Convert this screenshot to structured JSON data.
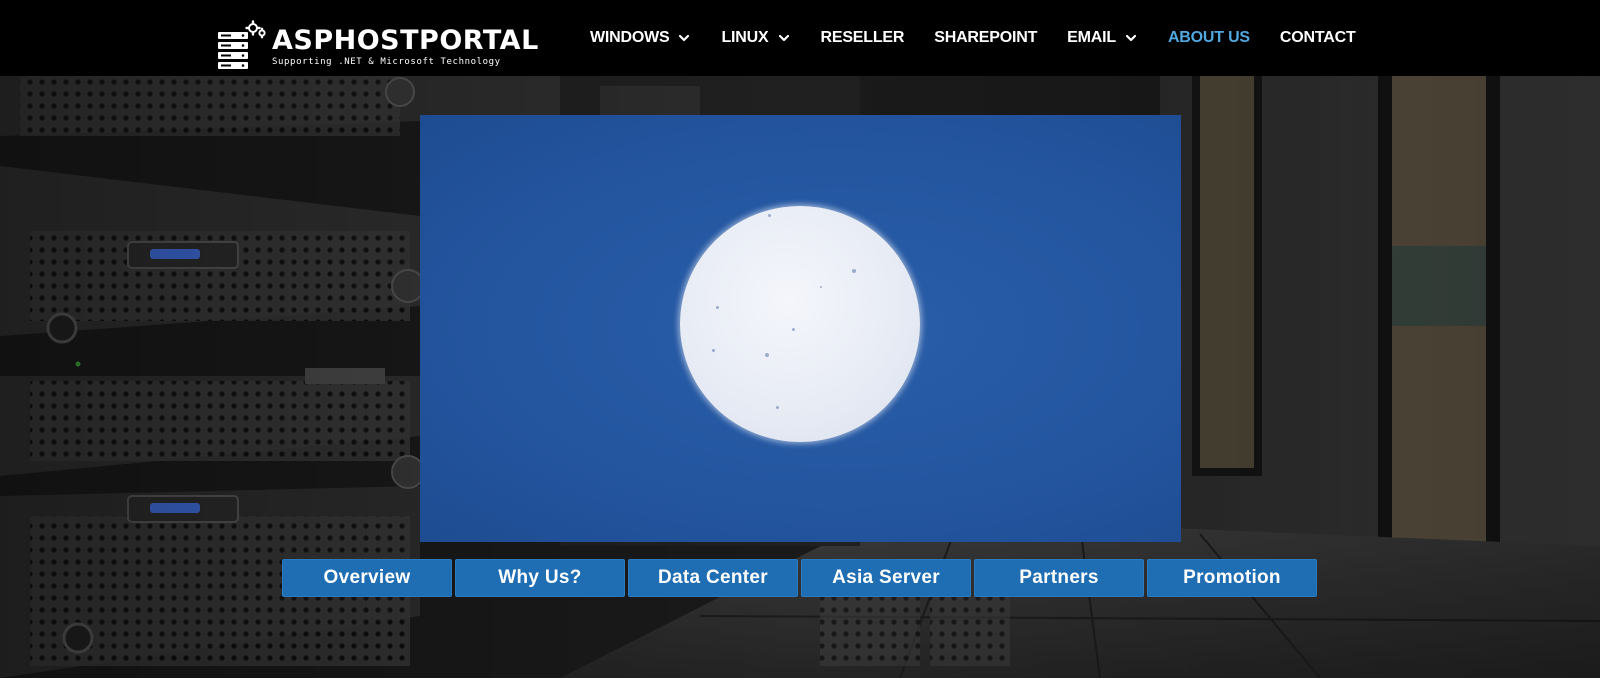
{
  "brand": {
    "name": "ASPHOSTPORTAL",
    "tagline": "Supporting .NET & Microsoft Technology",
    "icon": "server-gear-logo-icon"
  },
  "nav": {
    "items": [
      {
        "label": "WINDOWS",
        "has_dropdown": true
      },
      {
        "label": "LINUX",
        "has_dropdown": true
      },
      {
        "label": "RESELLER",
        "has_dropdown": false
      },
      {
        "label": "SHAREPOINT",
        "has_dropdown": false
      },
      {
        "label": "EMAIL",
        "has_dropdown": true
      },
      {
        "label": "ABOUT US",
        "has_dropdown": false,
        "active": true
      },
      {
        "label": "CONTACT",
        "has_dropdown": false
      }
    ],
    "active_color": "#4fa8e0"
  },
  "hero": {
    "background": "dark data center server racks",
    "video_color": "#2456a0",
    "tabs": [
      {
        "label": "Overview"
      },
      {
        "label": "Why Us?"
      },
      {
        "label": "Data Center"
      },
      {
        "label": "Asia Server"
      },
      {
        "label": "Partners"
      },
      {
        "label": "Promotion"
      }
    ],
    "tab_color": "#1f6db3"
  }
}
